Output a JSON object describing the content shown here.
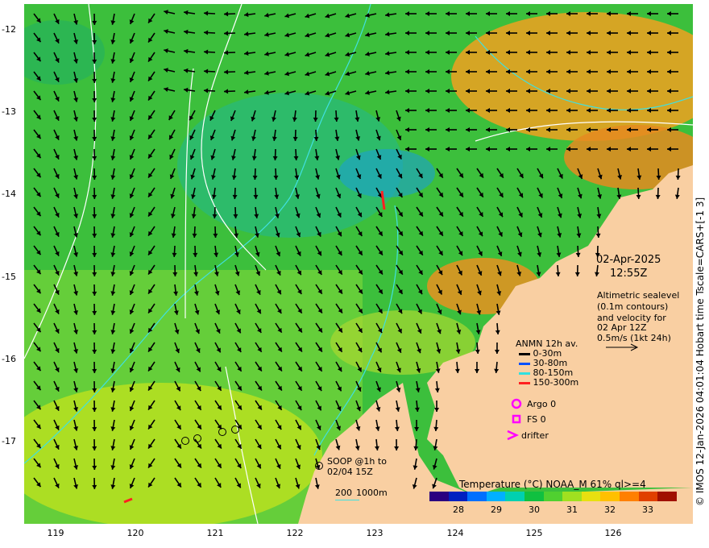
{
  "map": {
    "y_ticks": [
      "-12",
      "-13",
      "-14",
      "-15",
      "-16",
      "-17"
    ],
    "x_ticks": [
      "119",
      "120",
      "121",
      "122",
      "123",
      "124",
      "125",
      "126"
    ]
  },
  "timestamp": {
    "date": "02-Apr-2025",
    "time": "12:55Z"
  },
  "altimetry_note": {
    "line1": "Altimetric sealevel",
    "line2": "(0.1m contours)",
    "line3": "and velocity for",
    "line4": "02 Apr 12Z",
    "line5": "0.5m/s (1kt 24h)"
  },
  "anmn_legend": {
    "title": "ANMN 12h av.",
    "items": [
      {
        "label": "0-30m",
        "color": "#000000"
      },
      {
        "label": "30-80m",
        "color": "#0050ff"
      },
      {
        "label": "80-150m",
        "color": "#30e0e0"
      },
      {
        "label": "150-300m",
        "color": "#ff2020"
      }
    ]
  },
  "platforms": {
    "argo": "Argo 0",
    "fs": "FS 0",
    "drifter": "drifter"
  },
  "soop": {
    "line1": "SOOP @1h to",
    "line2": "02/04 15Z"
  },
  "isobath": {
    "a": "200",
    "b": "1000m"
  },
  "colorbar": {
    "title": "Temperature (°C) NOAA_M 61% ql>=4",
    "ticks": [
      "28",
      "29",
      "30",
      "31",
      "32",
      "33"
    ],
    "colors": [
      "#2a0080",
      "#0020c0",
      "#0070ff",
      "#00b0ff",
      "#00d0b0",
      "#10c040",
      "#50d030",
      "#a0e020",
      "#e8e010",
      "#ffc000",
      "#ff8000",
      "#e04000",
      "#a01000"
    ]
  },
  "side_caption": "© IMOS 12-Jan-2026 04:01:04 Hobart time Tscale=CARS+[-1 3]",
  "colors": {
    "land": "#f9cfa2",
    "sea_base": "#3cbf3c",
    "warm_patch": "#f0a020"
  }
}
